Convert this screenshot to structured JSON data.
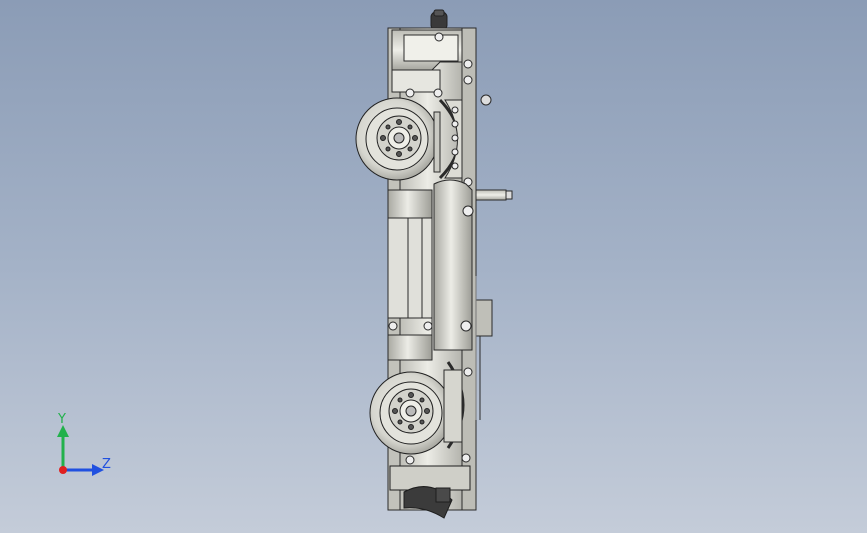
{
  "viewport": {
    "background_top": "#8b9cb6",
    "background_bottom": "#c4ccd9"
  },
  "model": {
    "part_color": "#d9d9d2",
    "edge_color": "#2b2b2b"
  },
  "triad": {
    "y_label": "Y",
    "z_label": "Z",
    "y_color": "#22b14c",
    "z_color": "#2050e0",
    "x_color": "#e02020"
  }
}
